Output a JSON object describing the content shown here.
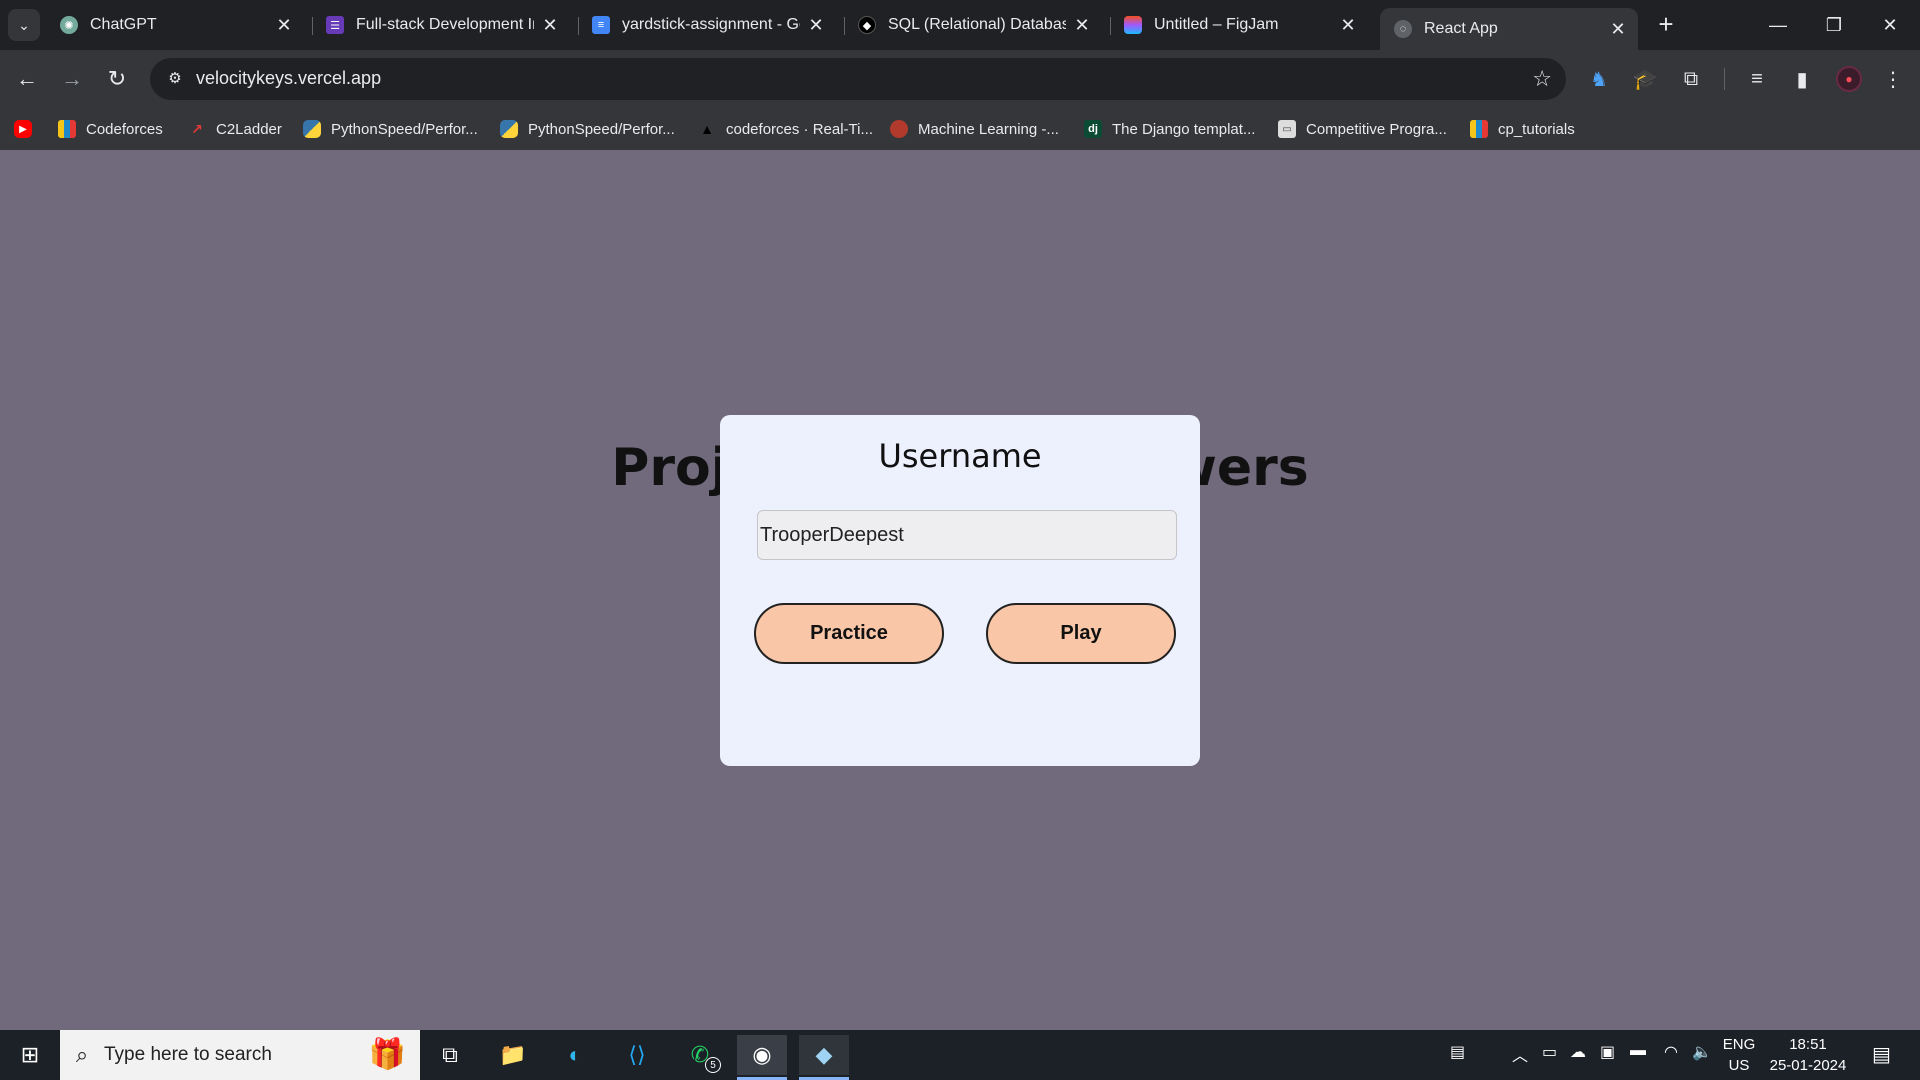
{
  "browser": {
    "tabs": [
      {
        "title": "ChatGPT",
        "icon": "chatgpt-icon",
        "color": "#74aa9c"
      },
      {
        "title": "Full-stack Development Int",
        "icon": "forms-icon",
        "color": "#673ab7"
      },
      {
        "title": "yardstick-assignment - Goo",
        "icon": "docs-icon",
        "color": "#4285f4"
      },
      {
        "title": "SQL (Relational) Databases",
        "icon": "site-icon",
        "color": "#000000"
      },
      {
        "title": "Untitled – FigJam",
        "icon": "figma-icon",
        "color": "#f24e1e"
      },
      {
        "title": "React App",
        "icon": "globe-icon",
        "color": "#5f6368",
        "active": true
      }
    ],
    "new_tab_label": "+",
    "url": "velocitykeys.vercel.app",
    "bookmarks": [
      {
        "label": "",
        "icon": "youtube-icon",
        "color": "#ff0000"
      },
      {
        "label": "Codeforces",
        "icon": "codeforces-icon",
        "color": "#1f8acb"
      },
      {
        "label": "C2Ladder",
        "icon": "c2ladder-icon",
        "color": "#e53935"
      },
      {
        "label": "PythonSpeed/Perfor...",
        "icon": "python-icon",
        "color": "#3776ab"
      },
      {
        "label": "PythonSpeed/Perfor...",
        "icon": "python-icon",
        "color": "#3776ab"
      },
      {
        "label": "codeforces · Real-Ti...",
        "icon": "triangle-icon",
        "color": "#000000"
      },
      {
        "label": "Machine Learning -...",
        "icon": "ml-icon",
        "color": "#b23a2c"
      },
      {
        "label": "The Django templat...",
        "icon": "django-icon",
        "color": "#0c4b33"
      },
      {
        "label": "Competitive Progra...",
        "icon": "cp-icon",
        "color": "#dddddd"
      },
      {
        "label": "cp_tutorials",
        "icon": "codeforces-icon",
        "color": "#1f8acb"
      }
    ]
  },
  "app": {
    "headline": "Project for Interviewers",
    "modal": {
      "title": "Username",
      "username_value": "TrooperDeepest",
      "practice_label": "Practice",
      "play_label": "Play"
    }
  },
  "taskbar": {
    "search_placeholder": "Type here to search",
    "whatsapp_badge": "5",
    "language": "ENG",
    "region": "US",
    "time": "18:51",
    "date": "25-01-2024"
  },
  "colors": {
    "page_bg": "#716a7d",
    "modal_bg": "#ecf1fd",
    "button_bg": "#f9c7a8"
  }
}
